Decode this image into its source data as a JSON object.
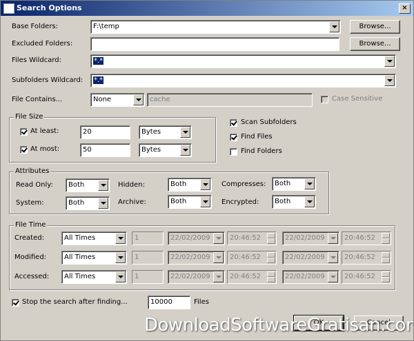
{
  "window": {
    "title": "Search Options",
    "close": "×"
  },
  "base_folders": {
    "label": "Base Folders:",
    "value": "F:\\temp",
    "button": "Browse..."
  },
  "excluded_folders": {
    "label": "Excluded Folders:",
    "value": "",
    "button": "Browse..."
  },
  "files_wildcard": {
    "label": "Files Wildcard:",
    "value": "*.*"
  },
  "subfolders_wildcard": {
    "label": "Subfolders Wildcard:",
    "value": "*.*"
  },
  "file_contains": {
    "label": "File Contains...",
    "mode": "None",
    "text": "cache",
    "case_label": "Case Sensitive"
  },
  "file_size": {
    "legend": "File Size",
    "at_least": {
      "label": "At least:",
      "value": "20",
      "unit": "Bytes"
    },
    "at_most": {
      "label": "At most:",
      "value": "50",
      "unit": "Bytes"
    }
  },
  "options": {
    "scan_subfolders": "Scan Subfolders",
    "find_files": "Find Files",
    "find_folders": "Find Folders"
  },
  "attributes": {
    "legend": "Attributes",
    "read_only": {
      "label": "Read Only:",
      "value": "Both"
    },
    "hidden": {
      "label": "Hidden:",
      "value": "Both"
    },
    "compresses": {
      "label": "Compresses:",
      "value": "Both"
    },
    "system": {
      "label": "System:",
      "value": "Both"
    },
    "archive": {
      "label": "Archive:",
      "value": "Both"
    },
    "encrypted": {
      "label": "Encrypted:",
      "value": "Both"
    }
  },
  "file_time": {
    "legend": "File Time",
    "rows": [
      {
        "label": "Created:",
        "mode": "All Times",
        "count": "1",
        "date1": "22/02/2009",
        "time1": "20:46:52",
        "date2": "22/02/2009",
        "time2": "20:46:52"
      },
      {
        "label": "Modified:",
        "mode": "All Times",
        "count": "1",
        "date1": "22/02/2009",
        "time1": "20:46:52",
        "date2": "22/02/2009",
        "time2": "20:46:52"
      },
      {
        "label": "Accessed:",
        "mode": "All Times",
        "count": "1",
        "date1": "22/02/2009",
        "time1": "20:46:52",
        "date2": "22/02/2009",
        "time2": "20:46:52"
      }
    ]
  },
  "stop": {
    "label": "Stop the search after finding...",
    "value": "10000",
    "suffix": "Files"
  },
  "buttons": {
    "ok": "OK",
    "cancel": "Cancel"
  },
  "watermark": "DownloadSoftwareGratisan.com"
}
